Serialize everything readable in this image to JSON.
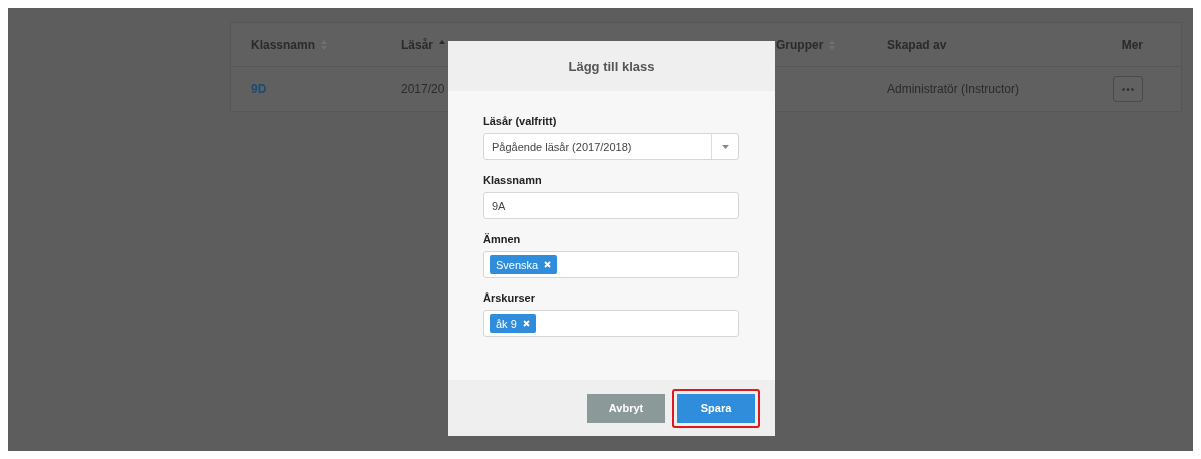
{
  "table": {
    "columns": [
      {
        "label": "Klassnamn",
        "sortable": true,
        "sorted": false
      },
      {
        "label": "Läsår",
        "sortable": true,
        "sorted": true
      },
      {
        "label": "Grupper",
        "sortable": true,
        "sorted": false
      },
      {
        "label": "Skapad av",
        "sortable": false,
        "sorted": false
      },
      {
        "label": "Mer",
        "sortable": false,
        "sorted": false
      }
    ],
    "rows": [
      {
        "name": "9D",
        "year": "2017/20",
        "creator": "Administratör (Instructor)"
      }
    ]
  },
  "dialog": {
    "title": "Lägg till klass",
    "fields": [
      {
        "kind": "select",
        "label": "Läsår (valfritt)",
        "value": "Pågående läsår (2017/2018)"
      },
      {
        "kind": "text",
        "label": "Klassnamn",
        "value": "9A"
      },
      {
        "kind": "tags",
        "label": "Ämnen",
        "tags": [
          "Svenska"
        ]
      },
      {
        "kind": "tags",
        "label": "Årskurser",
        "tags": [
          "åk 9"
        ]
      }
    ],
    "buttons": [
      {
        "label": "Avbryt",
        "kind": "secondary",
        "highlighted": false
      },
      {
        "label": "Spara",
        "kind": "primary",
        "highlighted": true
      }
    ]
  }
}
